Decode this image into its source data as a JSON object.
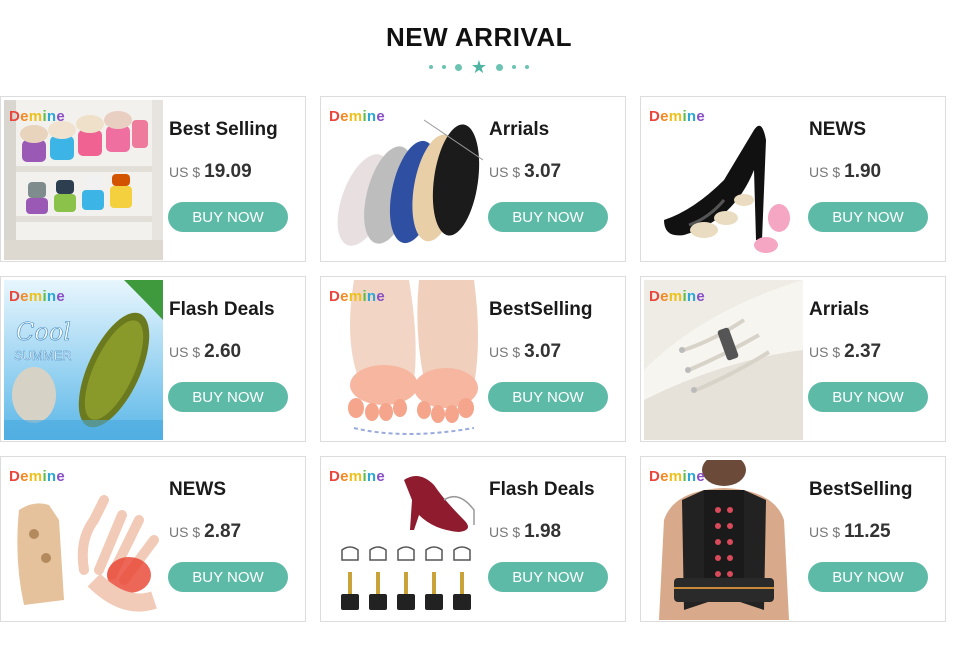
{
  "header": {
    "title": "NEW ARRIVAL"
  },
  "brand_letters": [
    "D",
    "e",
    "m",
    "i",
    "n",
    "e"
  ],
  "accent_color": "#5cbaa6",
  "products": [
    {
      "title": "Best Selling",
      "currency": "US $",
      "price": "19.09",
      "button": "BUY NOW",
      "image": "shoe-rack-image"
    },
    {
      "title": "Arrials",
      "currency": "US $",
      "price": "3.07",
      "button": "BUY NOW",
      "image": "insoles-image"
    },
    {
      "title": "NEWS",
      "currency": "US $",
      "price": "1.90",
      "button": "BUY NOW",
      "image": "heel-grips-image"
    },
    {
      "title": "Flash Deals",
      "currency": "US $",
      "price": "2.60",
      "button": "BUY NOW",
      "image": "cool-insole-image",
      "image_text": [
        "Cool",
        "SUMMER"
      ]
    },
    {
      "title": "BestSelling",
      "currency": "US $",
      "price": "3.07",
      "button": "BUY NOW",
      "image": "toe-cushion-image"
    },
    {
      "title": "Arrials",
      "currency": "US $",
      "price": "2.37",
      "button": "BUY NOW",
      "image": "shoelace-image"
    },
    {
      "title": "NEWS",
      "currency": "US $",
      "price": "2.87",
      "button": "BUY NOW",
      "image": "thumb-brace-image"
    },
    {
      "title": "Flash Deals",
      "currency": "US $",
      "price": "1.98",
      "button": "BUY NOW",
      "image": "heel-tips-image"
    },
    {
      "title": "BestSelling",
      "currency": "US $",
      "price": "11.25",
      "button": "BUY NOW",
      "image": "posture-brace-image"
    }
  ]
}
